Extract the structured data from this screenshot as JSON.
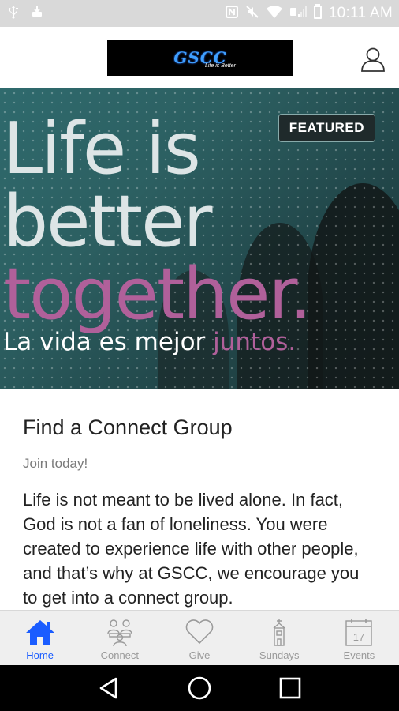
{
  "status_bar": {
    "time": "10:11 AM",
    "icons": [
      "usb-icon",
      "download-icon",
      "nfc-icon",
      "mute-icon",
      "wifi-icon",
      "signal-icon",
      "battery-icon"
    ]
  },
  "header": {
    "logo_text": "GSCC",
    "logo_tagline": "Life is Better",
    "profile_icon": "person-icon"
  },
  "hero": {
    "badge": "FEATURED",
    "line1": "Life is",
    "line2": "better",
    "line3": "together.",
    "line4_main": "La vida es mejor ",
    "line4_accent": "juntos.",
    "colors": {
      "light_text": "#dde5e6",
      "accent": "#b0609a",
      "teal_bg": "#2f6a6d"
    }
  },
  "article": {
    "title": "Find a Connect Group",
    "subtitle": "Join today!",
    "body": "Life is not meant to be lived alone. In fact, God is not a fan of loneliness. You were created to experience life with other people, and that’s why at GSCC, we encourage you to get into a connect group."
  },
  "tabs": [
    {
      "label": "Home",
      "icon": "home-icon",
      "active": true
    },
    {
      "label": "Connect",
      "icon": "people-icon",
      "active": false
    },
    {
      "label": "Give",
      "icon": "heart-icon",
      "active": false
    },
    {
      "label": "Sundays",
      "icon": "church-icon",
      "active": false
    },
    {
      "label": "Events",
      "icon": "calendar-icon",
      "active": false,
      "calendar_day": "17"
    }
  ],
  "colors": {
    "active_tab": "#1a5cff",
    "inactive_tab": "#9a9a9a"
  }
}
